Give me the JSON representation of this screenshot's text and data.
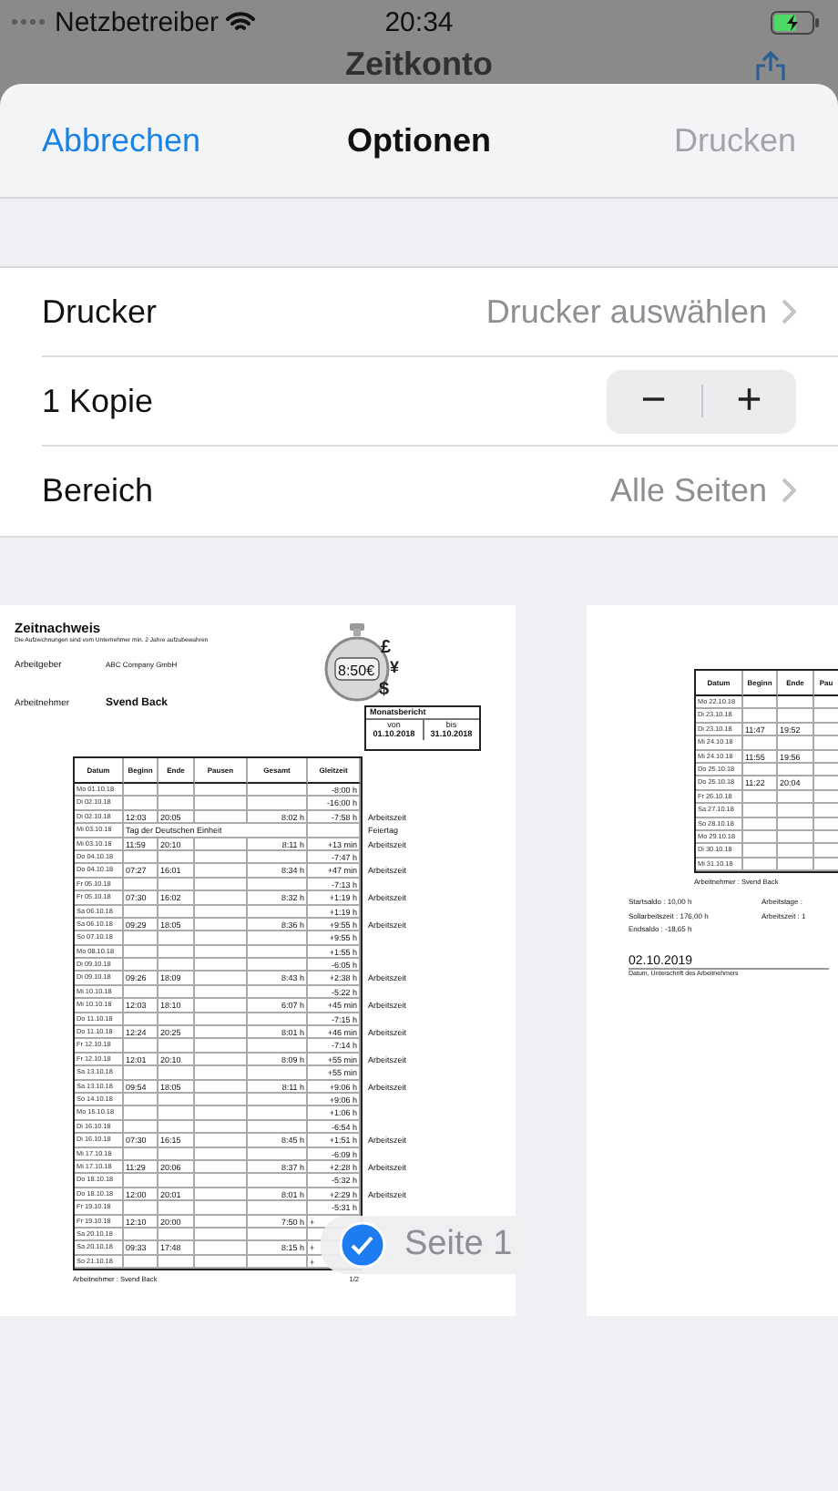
{
  "status_bar": {
    "carrier": "Netzbetreiber",
    "time": "20:34"
  },
  "background_nav": {
    "title": "Zeitkonto"
  },
  "sheet": {
    "cancel": "Abbrechen",
    "title": "Optionen",
    "print": {
      "label": "Drucken",
      "disabled": true
    }
  },
  "options": [
    {
      "kind": "link",
      "label": "Drucker",
      "value": "Drucker auswählen"
    },
    {
      "kind": "stepper",
      "label": "1 Kopie",
      "minus": "−",
      "plus": "+"
    },
    {
      "kind": "link",
      "label": "Bereich",
      "value": "Alle Seiten"
    }
  ],
  "pages": [
    {
      "title": "Zeitnachweis",
      "subtitle": "Die Aufzeichnungen sind vom Unternehmer min. 2 Jahre aufzubewahren",
      "employer_label": "Arbeitgeber",
      "employer": "ABC Company GmbH",
      "employee_label": "Arbeitnehmer",
      "employee": "Svend Back",
      "logo": {
        "display": "8:50€",
        "symbols": [
          "£",
          "¥",
          "$"
        ]
      },
      "report": {
        "title": "Monatsbericht",
        "from_label": "von",
        "from": "01.10.2018",
        "to_label": "bis",
        "to": "31.10.2018"
      },
      "columns": [
        "Datum",
        "Beginn",
        "Ende",
        "Pausen",
        "Gesamt",
        "Gleitzeit"
      ],
      "rows": [
        {
          "kind": "entry",
          "date": "Mo 01.10.18",
          "balance": "-8:00 h"
        },
        {
          "kind": "entry",
          "date": "Di 02.10.18",
          "balance": "-16:00 h"
        },
        {
          "kind": "entry",
          "date": "Di 02.10.18",
          "begin": "12:03",
          "end": "20:05",
          "total": "8:02 h",
          "balance": "-7:58 h",
          "note": "Arbeitszeit"
        },
        {
          "kind": "holiday",
          "date": "Mi 03.10.18",
          "text": "Tag der Deutschen Einheit",
          "note": "Feiertag"
        },
        {
          "kind": "entry",
          "date": "Mi 03.10.18",
          "begin": "11:59",
          "end": "20:10",
          "total": "8:11 h",
          "balance": "+13 min",
          "note": "Arbeitszeit"
        },
        {
          "kind": "entry",
          "date": "Do 04.10.18",
          "balance": "-7:47 h"
        },
        {
          "kind": "entry",
          "date": "Do 04.10.18",
          "begin": "07:27",
          "end": "16:01",
          "total": "8:34 h",
          "balance": "+47 min",
          "note": "Arbeitszeit"
        },
        {
          "kind": "entry",
          "date": "Fr 05.10.18",
          "balance": "-7:13 h"
        },
        {
          "kind": "entry",
          "date": "Fr 05.10.18",
          "begin": "07:30",
          "end": "16:02",
          "total": "8:32 h",
          "balance": "+1:19 h",
          "note": "Arbeitszeit"
        },
        {
          "kind": "entry",
          "date": "Sa 06.10.18",
          "balance": "+1:19 h"
        },
        {
          "kind": "entry",
          "date": "Sa 06.10.18",
          "begin": "09:29",
          "end": "18:05",
          "total": "8:36 h",
          "balance": "+9:55 h",
          "note": "Arbeitszeit"
        },
        {
          "kind": "entry",
          "date": "So 07.10.18",
          "balance": "+9:55 h"
        },
        {
          "kind": "entry",
          "date": "Mo 08.10.18",
          "balance": "+1:55 h"
        },
        {
          "kind": "entry",
          "date": "Di 09.10.18",
          "balance": "-6:05 h"
        },
        {
          "kind": "entry",
          "date": "Di 09.10.18",
          "begin": "09:26",
          "end": "18:09",
          "total": "8:43 h",
          "balance": "+2:38 h",
          "note": "Arbeitszeit"
        },
        {
          "kind": "entry",
          "date": "Mi 10.10.18",
          "balance": "-5:22 h"
        },
        {
          "kind": "entry",
          "date": "Mi 10.10.18",
          "begin": "12:03",
          "end": "18:10",
          "total": "6:07 h",
          "balance": "+45 min",
          "note": "Arbeitszeit"
        },
        {
          "kind": "entry",
          "date": "Do 11.10.18",
          "balance": "-7:15 h"
        },
        {
          "kind": "entry",
          "date": "Do 11.10.18",
          "begin": "12:24",
          "end": "20:25",
          "total": "8:01 h",
          "balance": "+46 min",
          "note": "Arbeitszeit"
        },
        {
          "kind": "entry",
          "date": "Fr 12.10.18",
          "balance": "-7:14 h"
        },
        {
          "kind": "entry",
          "date": "Fr 12.10.18",
          "begin": "12:01",
          "end": "20:10",
          "total": "8:09 h",
          "balance": "+55 min",
          "note": "Arbeitszeit"
        },
        {
          "kind": "entry",
          "date": "Sa 13.10.18",
          "balance": "+55 min"
        },
        {
          "kind": "entry",
          "date": "Sa 13.10.18",
          "begin": "09:54",
          "end": "18:05",
          "total": "8:11 h",
          "balance": "+9:06 h",
          "note": "Arbeitszeit"
        },
        {
          "kind": "entry",
          "date": "So 14.10.18",
          "balance": "+9:06 h"
        },
        {
          "kind": "entry",
          "date": "Mo 15.10.18",
          "balance": "+1:06 h"
        },
        {
          "kind": "entry",
          "date": "Di 16.10.18",
          "balance": "-6:54 h"
        },
        {
          "kind": "entry",
          "date": "Di 16.10.18",
          "begin": "07:30",
          "end": "16:15",
          "total": "8:45 h",
          "balance": "+1:51 h",
          "note": "Arbeitszeit"
        },
        {
          "kind": "entry",
          "date": "Mi 17.10.18",
          "balance": "-6:09 h"
        },
        {
          "kind": "entry",
          "date": "Mi 17.10.18",
          "begin": "11:29",
          "end": "20:06",
          "total": "8:37 h",
          "balance": "+2:28 h",
          "note": "Arbeitszeit"
        },
        {
          "kind": "entry",
          "date": "Do 18.10.18",
          "balance": "-5:32 h"
        },
        {
          "kind": "entry",
          "date": "Do 18.10.18",
          "begin": "12:00",
          "end": "20:01",
          "total": "8:01 h",
          "balance": "+2:29 h",
          "note": "Arbeitszeit"
        },
        {
          "kind": "entry",
          "date": "Fr 19.10.18",
          "balance": "-5:31 h"
        },
        {
          "kind": "entry",
          "date": "Fr 19.10.18",
          "begin": "12:10",
          "end": "20:00",
          "total": "7:50 h",
          "balance": "+"
        },
        {
          "kind": "entry",
          "date": "Sa 20.10.18"
        },
        {
          "kind": "entry",
          "date": "Sa 20.10.18",
          "begin": "09:33",
          "end": "17:48",
          "total": "8:15 h",
          "balance": "+"
        },
        {
          "kind": "entry",
          "date": "So 21.10.18",
          "balance": "+"
        }
      ],
      "footer": "Arbeitnehmer : Svend Back",
      "page_number": "1/2"
    },
    {
      "columns": [
        "Datum",
        "Beginn",
        "Ende",
        "Pau"
      ],
      "rows": [
        {
          "kind": "entry",
          "date": "Mo 22.10.18"
        },
        {
          "kind": "entry",
          "date": "Di 23.10.18"
        },
        {
          "kind": "entry",
          "date": "Di 23.10.18",
          "begin": "11:47",
          "end": "19:52"
        },
        {
          "kind": "entry",
          "date": "Mi 24.10.18"
        },
        {
          "kind": "entry",
          "date": "Mi 24.10.18",
          "begin": "11:55",
          "end": "19:56"
        },
        {
          "kind": "entry",
          "date": "Do 25.10.18"
        },
        {
          "kind": "entry",
          "date": "Do 25.10.18",
          "begin": "11:22",
          "end": "20:04"
        },
        {
          "kind": "entry",
          "date": "Fr 26.10.18"
        },
        {
          "kind": "entry",
          "date": "Sa 27.10.18"
        },
        {
          "kind": "entry",
          "date": "So 28.10.18"
        },
        {
          "kind": "entry",
          "date": "Mo 29.10.18"
        },
        {
          "kind": "entry",
          "date": "Di 30.10.18"
        },
        {
          "kind": "entry",
          "date": "Mi 31.10.18"
        }
      ],
      "footer": "Arbeitnehmer : Svend Back",
      "summary_left": [
        "Startsaldo : 10,00 h",
        "Sollarbeitszeit : 176,00 h",
        "Endsaldo : -18,65 h"
      ],
      "summary_right": [
        "Arbeitstage :",
        "Arbeitszeit : 1"
      ],
      "date": "02.10.2019",
      "signature_caption": "Datum, Unterschrift des Arbeitnehmers"
    }
  ],
  "page_badge": {
    "label": "Seite 1",
    "selected": true
  }
}
